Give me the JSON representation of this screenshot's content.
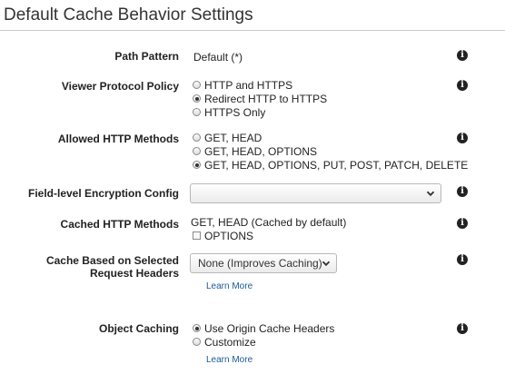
{
  "page": {
    "title": "Default Cache Behavior Settings"
  },
  "path_pattern": {
    "label": "Path Pattern",
    "value": "Default (*)"
  },
  "viewer_protocol_policy": {
    "label": "Viewer Protocol Policy",
    "options": [
      "HTTP and HTTPS",
      "Redirect HTTP to HTTPS",
      "HTTPS Only"
    ],
    "selected": "Redirect HTTP to HTTPS"
  },
  "allowed_http_methods": {
    "label": "Allowed HTTP Methods",
    "options": [
      "GET, HEAD",
      "GET, HEAD, OPTIONS",
      "GET, HEAD, OPTIONS, PUT, POST, PATCH, DELETE"
    ],
    "selected": "GET, HEAD, OPTIONS, PUT, POST, PATCH, DELETE"
  },
  "field_level_encryption": {
    "label": "Field-level Encryption Config",
    "value": ""
  },
  "cached_http_methods": {
    "label": "Cached HTTP Methods",
    "value": "GET, HEAD (Cached by default)",
    "option_label": "OPTIONS",
    "option_checked": false
  },
  "cache_headers": {
    "label_line1": "Cache Based on Selected",
    "label_line2": "Request Headers",
    "selected": "None (Improves Caching)",
    "learn_more": "Learn More"
  },
  "object_caching": {
    "label": "Object Caching",
    "options": [
      "Use Origin Cache Headers",
      "Customize"
    ],
    "selected": "Use Origin Cache Headers",
    "learn_more": "Learn More"
  },
  "info_icon_glyph": "i"
}
